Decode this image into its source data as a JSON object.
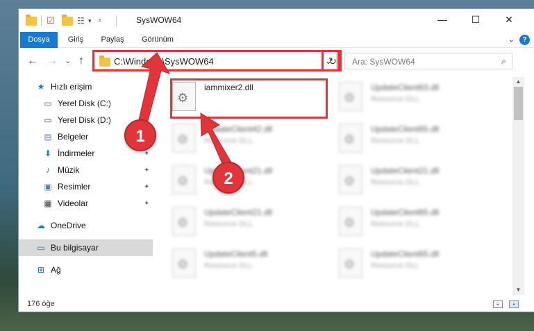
{
  "window": {
    "title": "SysWOW64",
    "minimize_glyph": "—",
    "maximize_glyph": "☐",
    "close_glyph": "✕"
  },
  "ribbon": {
    "tabs": [
      {
        "label": "Dosya"
      },
      {
        "label": "Giriş"
      },
      {
        "label": "Paylaş"
      },
      {
        "label": "Görünüm"
      }
    ],
    "help_glyph": "?"
  },
  "nav": {
    "back_glyph": "←",
    "forward_glyph": "→",
    "recent_glyph": "⌄",
    "up_glyph": "↑",
    "address": "C:\\Windows\\SysWOW64",
    "refresh_glyph": "↻",
    "search_placeholder": "Ara: SysWOW64"
  },
  "sidebar": {
    "items": [
      {
        "label": "Hızlı erişim",
        "icon": "star-icon",
        "color": "#1979ca"
      },
      {
        "label": "Yerel Disk (C:)",
        "icon": "drive-icon",
        "pinned": true
      },
      {
        "label": "Yerel Disk (D:)",
        "icon": "drive-icon",
        "pinned": true
      },
      {
        "label": "Belgeler",
        "icon": "document-icon",
        "pinned": true
      },
      {
        "label": "İndirmeler",
        "icon": "download-icon",
        "pinned": true
      },
      {
        "label": "Müzik",
        "icon": "music-icon",
        "pinned": true
      },
      {
        "label": "Resimler",
        "icon": "picture-icon",
        "pinned": true
      },
      {
        "label": "Videolar",
        "icon": "video-icon",
        "pinned": true
      },
      {
        "label": "OneDrive",
        "icon": "cloud-icon"
      },
      {
        "label": "Bu bilgisayar",
        "icon": "computer-icon",
        "selected": true
      },
      {
        "label": "Ağ",
        "icon": "network-icon"
      }
    ]
  },
  "files": {
    "main": {
      "name": "iammixer2.dll",
      "type": ""
    },
    "blurred": [
      {
        "name": "UpdateClient63.dll",
        "type": "Resource DLL"
      },
      {
        "name": "UpdateClient42.dll",
        "type": "Resource DLL"
      },
      {
        "name": "UpdateClient65.dll",
        "type": "Resource DLL"
      },
      {
        "name": "UpdateClient21.dll",
        "type": "Resource DLL"
      },
      {
        "name": "UpdateClient21.dll",
        "type": "Resource DLL"
      },
      {
        "name": "UpdateClient21.dll",
        "type": "Resource DLL"
      },
      {
        "name": "UpdateClient65.dll",
        "type": "Resource DLL"
      },
      {
        "name": "UpdateClient5.dll",
        "type": "Resource DLL"
      },
      {
        "name": "UpdateClient65.dll",
        "type": "Resource DLL"
      }
    ]
  },
  "status": {
    "count": "176 öğe"
  },
  "callouts": {
    "one": "1",
    "two": "2"
  },
  "colors": {
    "accent": "#1979ca",
    "highlight": "#e0363b",
    "folder": "#f3c343"
  }
}
